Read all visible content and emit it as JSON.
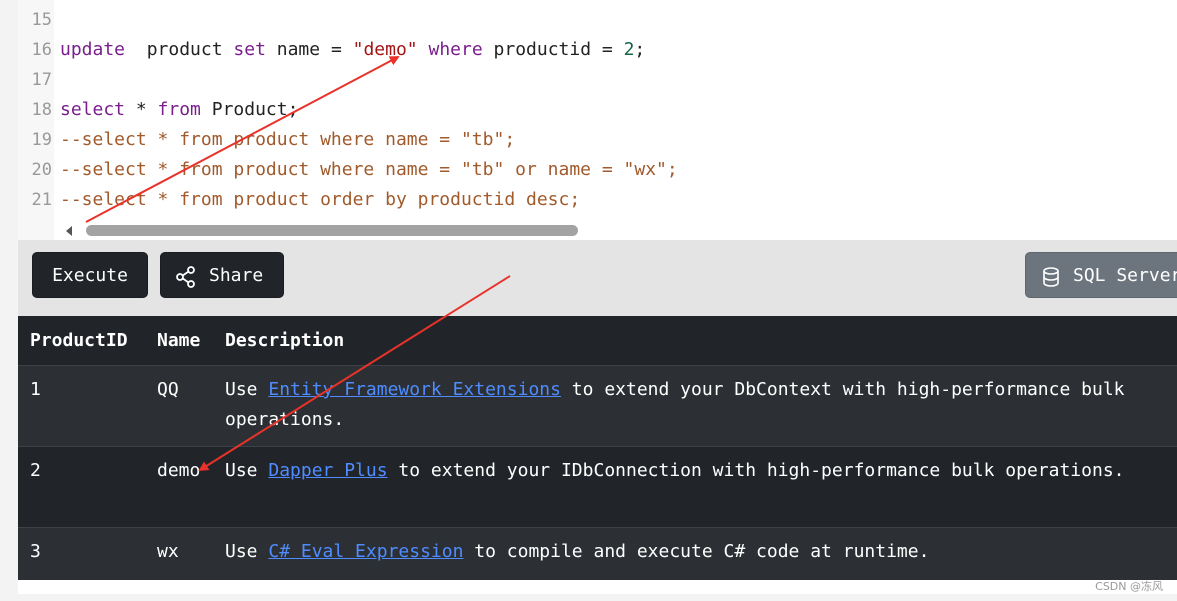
{
  "editor": {
    "lines": [
      {
        "num": "15",
        "tokens": []
      },
      {
        "num": "16",
        "tokens": [
          {
            "t": "kw",
            "v": "update"
          },
          {
            "t": "plain",
            "v": "  product "
          },
          {
            "t": "kw",
            "v": "set"
          },
          {
            "t": "plain",
            "v": " name = "
          },
          {
            "t": "str",
            "v": "\"demo\""
          },
          {
            "t": "plain",
            "v": " "
          },
          {
            "t": "kw",
            "v": "where"
          },
          {
            "t": "plain",
            "v": " productid = "
          },
          {
            "t": "num",
            "v": "2"
          },
          {
            "t": "plain",
            "v": ";"
          }
        ]
      },
      {
        "num": "17",
        "tokens": []
      },
      {
        "num": "18",
        "tokens": [
          {
            "t": "kw",
            "v": "select"
          },
          {
            "t": "plain",
            "v": " * "
          },
          {
            "t": "kw",
            "v": "from"
          },
          {
            "t": "plain",
            "v": " Product;"
          }
        ]
      },
      {
        "num": "19",
        "tokens": [
          {
            "t": "cm",
            "v": "--select * from product where name = \"tb\";"
          }
        ]
      },
      {
        "num": "20",
        "tokens": [
          {
            "t": "cm",
            "v": "--select * from product where name = \"tb\" or name = \"wx\";"
          }
        ]
      },
      {
        "num": "21",
        "tokens": [
          {
            "t": "cm",
            "v": "--select * from product order by productid desc;"
          }
        ]
      }
    ]
  },
  "toolbar": {
    "execute_label": "Execute",
    "share_label": "Share",
    "database_label": "SQL Server"
  },
  "results": {
    "columns": [
      "ProductID",
      "Name",
      "Description"
    ],
    "rows": [
      {
        "id": "1",
        "name": "QQ",
        "pre": "Use ",
        "link": "Entity Framework Extensions",
        "post": " to extend your DbContext with high-performance bulk operations."
      },
      {
        "id": "2",
        "name": "demo",
        "pre": "Use ",
        "link": "Dapper Plus",
        "post": " to extend your IDbConnection with high-performance bulk operations."
      },
      {
        "id": "3",
        "name": "wx",
        "pre": "Use ",
        "link": "C# Eval Expression",
        "post": " to compile and execute C# code at runtime."
      }
    ]
  },
  "watermark": "CSDN @冻风",
  "colors": {
    "annotation_arrow": "#e8322a",
    "table_bg": "#212529",
    "link": "#4f8cff"
  }
}
